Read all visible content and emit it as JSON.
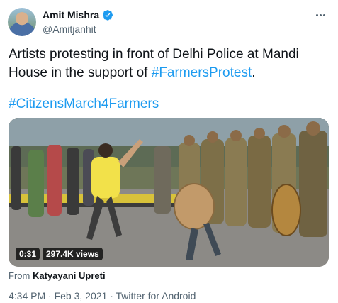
{
  "author": {
    "display_name": "Amit Mishra",
    "handle": "@Amitjanhit",
    "verified": true
  },
  "tweet": {
    "text_part1": "Artists protesting in front of Delhi Police at Mandi House in the support of ",
    "hashtag1": "#FarmersProtest",
    "text_part2": ".",
    "hashtag2": "#CitizensMarch4Farmers"
  },
  "video": {
    "duration": "0:31",
    "views": "297.4K views"
  },
  "attribution": {
    "prefix": "From",
    "source_name": "Katyayani Upreti"
  },
  "meta": {
    "time": "4:34 PM",
    "date": "Feb 3, 2021",
    "separator": "·",
    "client": "Twitter for Android"
  },
  "colors": {
    "accent": "#1d9bf0",
    "muted": "#536471"
  },
  "icons": [
    "verified-badge-icon",
    "more-options-icon"
  ]
}
